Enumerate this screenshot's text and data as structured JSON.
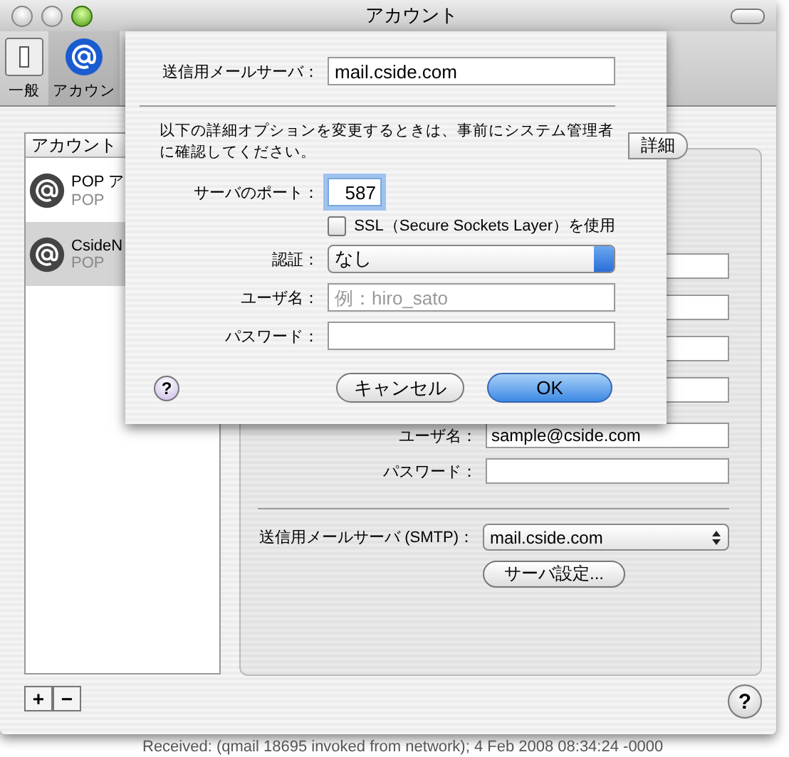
{
  "window": {
    "title": "アカウント"
  },
  "toolbar": [
    {
      "label": "一般",
      "kind": "switch",
      "selected": false
    },
    {
      "label": "アカウン",
      "kind": "at",
      "selected": true
    }
  ],
  "accounts": {
    "header": "アカウント",
    "items": [
      {
        "name": "POP ア",
        "type": "POP",
        "selected": false
      },
      {
        "name": "CsideN",
        "type": "POP",
        "selected": true
      }
    ]
  },
  "panel": {
    "tab": {
      "label": "詳細",
      "selected": false
    },
    "user_label": "ユーザ名：",
    "user_value": "sample@cside.com",
    "password_label": "パスワード：",
    "smtp_label": "送信用メールサーバ (SMTP)：",
    "smtp_value": "mail.cside.com",
    "server_button": "サーバ設定..."
  },
  "sheet": {
    "server_label": "送信用メールサーバ：",
    "server_value": "mail.cside.com",
    "note": "以下の詳細オプションを変更するときは、事前にシステム管理者に確認してください。",
    "port_label": "サーバのポート：",
    "port_value": "587",
    "ssl": {
      "label": "SSL（Secure Sockets Layer）を使用",
      "checked": false
    },
    "auth_label": "認証：",
    "auth_value": "なし",
    "user_label": "ユーザ名：",
    "user_placeholder": "例：hiro_sato",
    "password_label": "パスワード：",
    "help": "?",
    "cancel": "キャンセル",
    "ok": "OK"
  },
  "help": "?",
  "add": "+",
  "remove": "−",
  "background_text": "Received:  (qmail 18695 invoked from network); 4 Feb 2008 08:34:24 -0000"
}
